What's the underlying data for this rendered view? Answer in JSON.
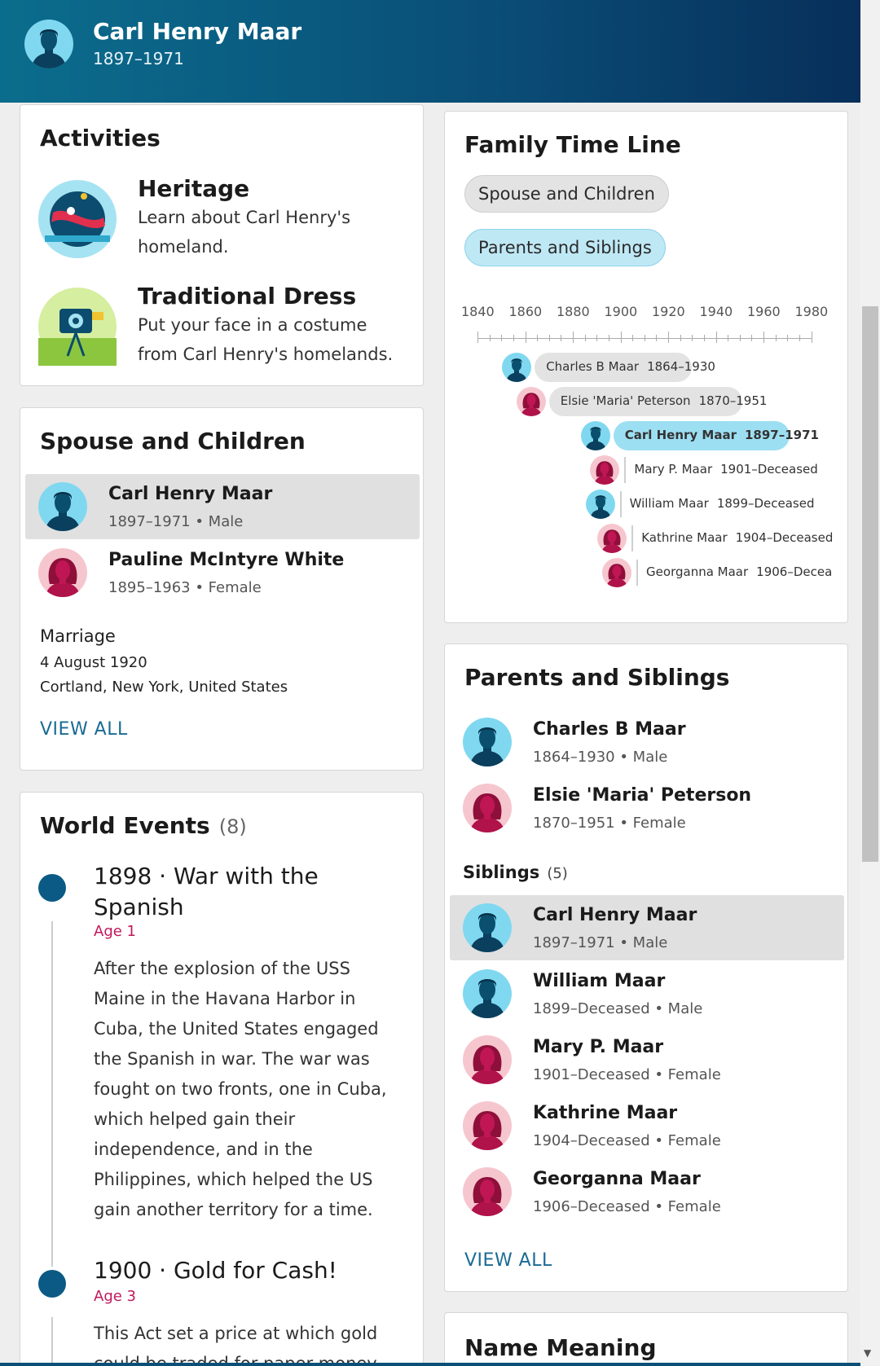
{
  "header": {
    "name": "Carl Henry Maar",
    "dates": "1897–1971"
  },
  "activities": {
    "title": "Activities",
    "items": [
      {
        "title": "Heritage",
        "desc": "Learn about Carl Henry's homeland.",
        "icon": "globe-illustration"
      },
      {
        "title": "Traditional Dress",
        "desc": "Put your face in a costume from Carl Henry's homelands.",
        "icon": "camera-illustration"
      }
    ]
  },
  "spouse": {
    "title": "Spouse and Children",
    "people": [
      {
        "name": "Carl Henry Maar",
        "info": "1897–1971 • Male",
        "gender": "male"
      },
      {
        "name": "Pauline McIntyre White",
        "info": "1895–1963 • Female",
        "gender": "female"
      }
    ],
    "marriage_label": "Marriage",
    "marriage_date": "4 August 1920",
    "marriage_place": "Cortland, New York, United States",
    "view_all": "VIEW ALL"
  },
  "world_events": {
    "title": "World Events",
    "count": "(8)",
    "events": [
      {
        "title": "1898 · War with the Spanish",
        "age": "Age 1",
        "desc": "After the explosion of the USS Maine in the Havana Harbor in Cuba, the United States engaged the Spanish in war. The war was fought on two fronts, one in Cuba, which helped gain their independence, and in the Philippines, which helped the US gain another territory for a time."
      },
      {
        "title": "1900 · Gold for Cash!",
        "age": "Age 3",
        "desc": "This Act set a price at which gold could be traded for paper money"
      }
    ]
  },
  "timeline": {
    "title": "Family Time Line",
    "pills": [
      "Spouse and Children",
      "Parents and Siblings"
    ],
    "years": [
      "1840",
      "1860",
      "1880",
      "1900",
      "1920",
      "1940",
      "1960",
      "1980"
    ],
    "entries": [
      {
        "name": "Charles B Maar",
        "dates": "1864–1930",
        "gender": "male"
      },
      {
        "name": "Elsie 'Maria' Peterson",
        "dates": "1870–1951",
        "gender": "female"
      },
      {
        "name": "Carl Henry Maar",
        "dates": "1897–1971",
        "gender": "male"
      },
      {
        "name": "Mary P. Maar",
        "dates": "1901–Deceased",
        "gender": "female"
      },
      {
        "name": "William Maar",
        "dates": "1899–Deceased",
        "gender": "male"
      },
      {
        "name": "Kathrine Maar",
        "dates": "1904–Deceased",
        "gender": "female"
      },
      {
        "name": "Georganna Maar",
        "dates": "1906–Decea",
        "gender": "female"
      }
    ]
  },
  "parents": {
    "title": "Parents and Siblings",
    "parents": [
      {
        "name": "Charles B Maar",
        "info": "1864–1930 • Male",
        "gender": "male"
      },
      {
        "name": "Elsie 'Maria' Peterson",
        "info": "1870–1951 • Female",
        "gender": "female"
      }
    ],
    "siblings_label": "Siblings",
    "siblings_count": "(5)",
    "siblings": [
      {
        "name": "Carl Henry Maar",
        "info": "1897–1971 • Male",
        "gender": "male"
      },
      {
        "name": "William Maar",
        "info": "1899–Deceased • Male",
        "gender": "male"
      },
      {
        "name": "Mary P. Maar",
        "info": "1901–Deceased • Female",
        "gender": "female"
      },
      {
        "name": "Kathrine Maar",
        "info": "1904–Deceased • Female",
        "gender": "female"
      },
      {
        "name": "Georganna Maar",
        "info": "1906–Deceased • Female",
        "gender": "female"
      }
    ],
    "view_all": "VIEW ALL"
  },
  "name_meaning": {
    "title": "Name Meaning"
  },
  "colors": {
    "header_start": "#0b6d8d",
    "header_end": "#072f5a",
    "link": "#1a6b93",
    "age": "#c2185b",
    "male_bg": "#7fd8f0",
    "female_bg": "#f6c6cf"
  }
}
